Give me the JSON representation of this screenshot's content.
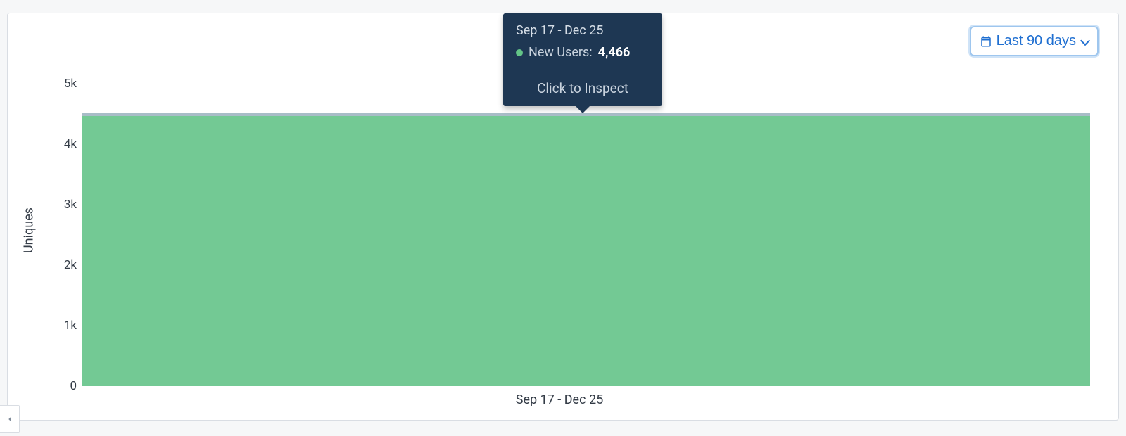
{
  "date_picker": {
    "label": "Last 90 days"
  },
  "tooltip": {
    "date_range": "Sep 17 - Dec 25",
    "series_label": "New Users:",
    "value": "4,466",
    "inspect_label": "Click to Inspect"
  },
  "axes": {
    "ylabel": "Uniques",
    "yticks": [
      "0",
      "1k",
      "2k",
      "3k",
      "4k",
      "5k"
    ],
    "ymax": 5000,
    "xlabel": "Sep 17 - Dec 25"
  },
  "colors": {
    "bar": "#73c994",
    "bar_border_top": "#a8bdc7",
    "tooltip_bg": "#1e3753",
    "accent": "#1f6fd1"
  },
  "chart_data": {
    "type": "bar",
    "categories": [
      "Sep 17 - Dec 25"
    ],
    "series": [
      {
        "name": "New Users",
        "values": [
          4466
        ]
      }
    ],
    "title": "",
    "xlabel": "",
    "ylabel": "Uniques",
    "ylim": [
      0,
      5000
    ],
    "yticks": [
      0,
      1000,
      2000,
      3000,
      4000,
      5000
    ]
  }
}
